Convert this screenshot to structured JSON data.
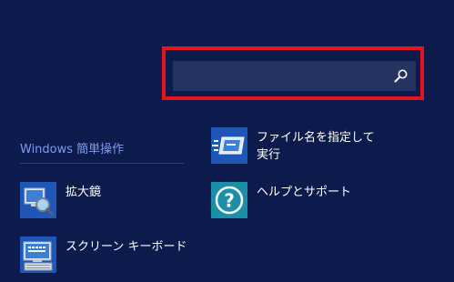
{
  "search": {
    "value": "",
    "placeholder": "",
    "icon": "search-icon"
  },
  "group": {
    "title": "Windows 簡単操作"
  },
  "apps": {
    "magnifier": {
      "label": "拡大鏡",
      "icon": "magnifier-icon"
    },
    "osk": {
      "label": "スクリーン キーボード",
      "icon": "on-screen-keyboard-icon"
    },
    "run": {
      "label_line1": "ファイル名を指定して",
      "label_line2": "実行",
      "icon": "run-icon"
    },
    "help": {
      "label": "ヘルプとサポート",
      "icon": "help-icon"
    }
  },
  "colors": {
    "background": "#0c1b4b",
    "search_box": "#243360",
    "highlight": "#e5141c",
    "group_title": "#7d9bf2",
    "help_tile": "#1b8fa8"
  }
}
